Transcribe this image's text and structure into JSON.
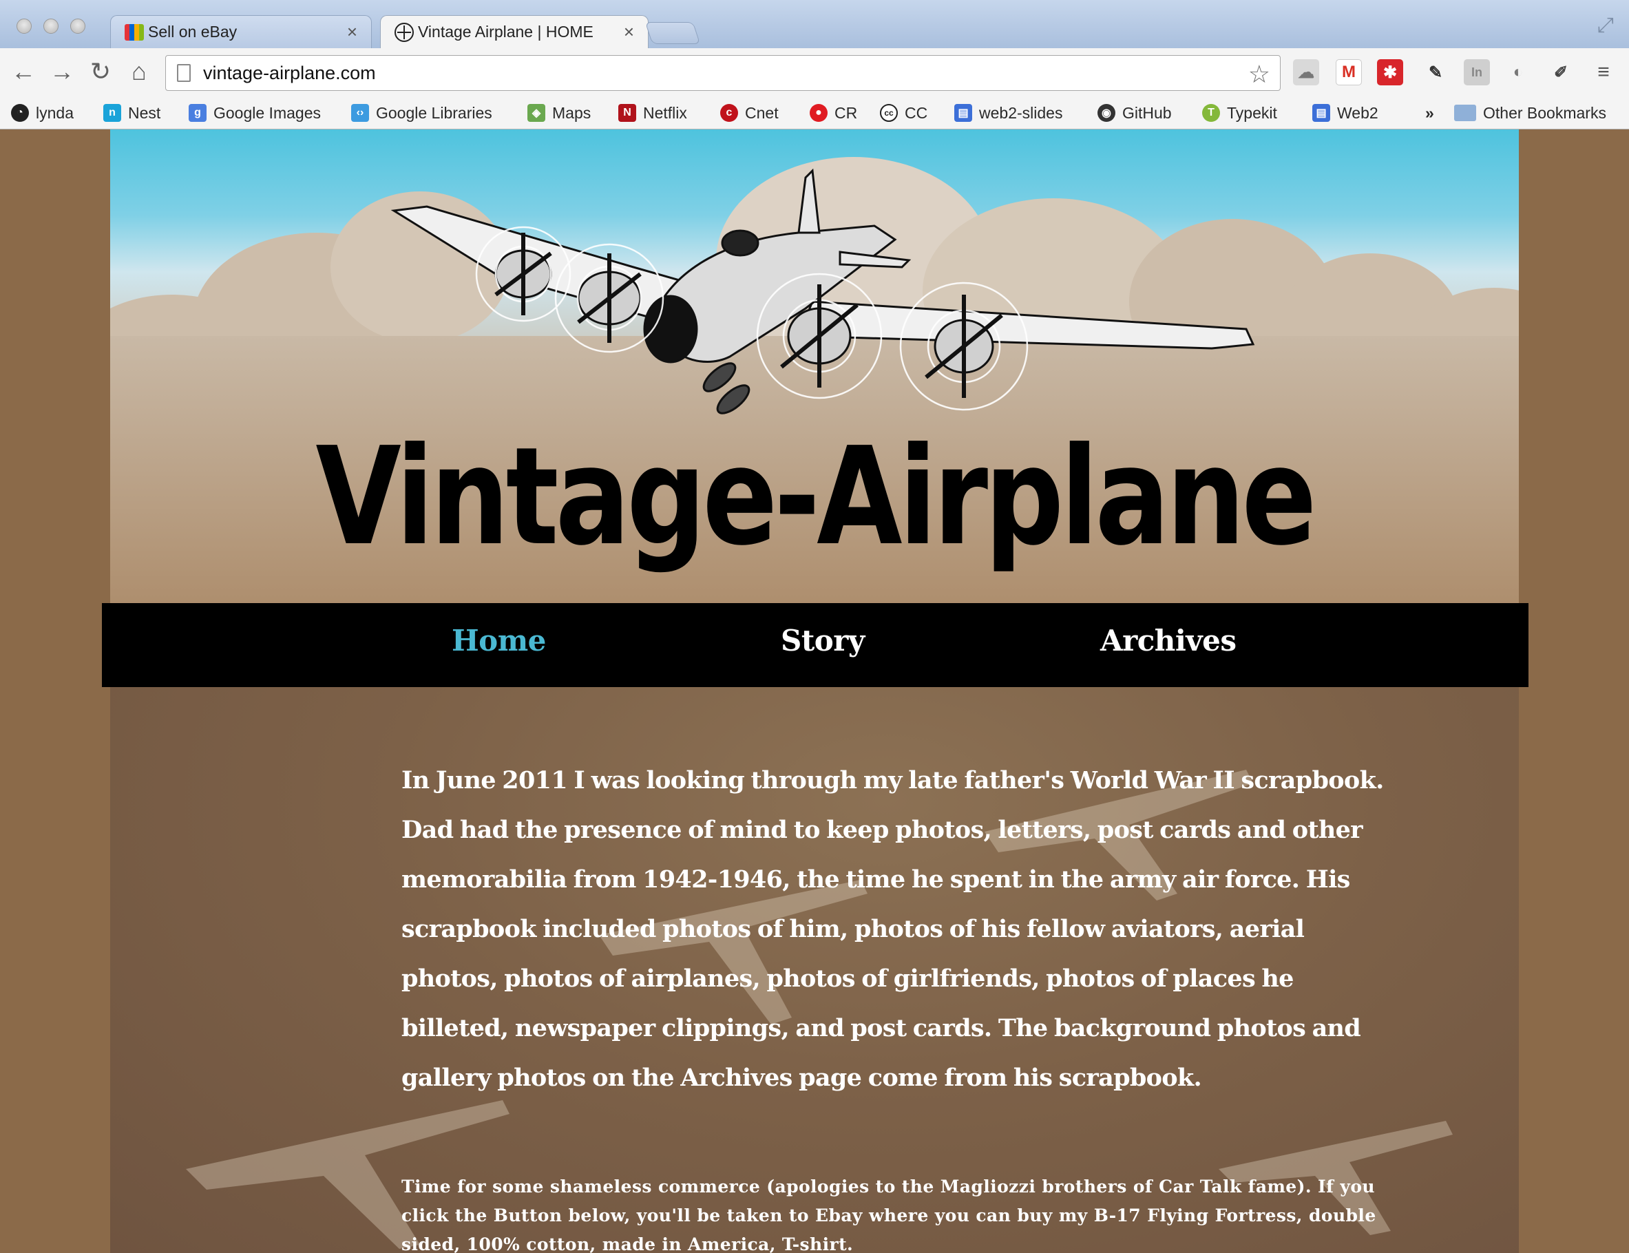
{
  "browser": {
    "tabs": [
      {
        "label": "Sell on eBay",
        "active": false
      },
      {
        "label": "Vintage Airplane | HOME",
        "active": true
      }
    ],
    "address": "vintage-airplane.com",
    "bookmarks": [
      {
        "label": "lynda",
        "icon": "lynda-icon",
        "color": "#333333"
      },
      {
        "label": "Nest",
        "icon": "nest-icon",
        "color": "#1aa3d9"
      },
      {
        "label": "Google Images",
        "icon": "google-images-icon",
        "color": "#4a7fe0"
      },
      {
        "label": "Google Libraries",
        "icon": "google-libraries-icon",
        "color": "#3d9be0"
      },
      {
        "label": "Maps",
        "icon": "maps-icon",
        "color": "#6aa84f"
      },
      {
        "label": "Netflix",
        "icon": "netflix-icon",
        "color": "#b0121b"
      },
      {
        "label": "Cnet",
        "icon": "cnet-icon",
        "color": "#c0121b"
      },
      {
        "label": "CR",
        "icon": "cr-icon",
        "color": "#e01b22"
      },
      {
        "label": "CC",
        "icon": "cc-icon",
        "color": "#222222"
      },
      {
        "label": "web2-slides",
        "icon": "slides-icon",
        "color": "#3c6fd8"
      },
      {
        "label": "GitHub",
        "icon": "github-icon",
        "color": "#333333"
      },
      {
        "label": "Typekit",
        "icon": "typekit-icon",
        "color": "#84b83a"
      },
      {
        "label": "Web2",
        "icon": "slides-icon",
        "color": "#3c6fd8"
      }
    ],
    "overflow": "»",
    "other_bookmarks": "Other Bookmarks"
  },
  "site": {
    "title": "Vintage-Airplane",
    "nav": [
      {
        "label": "Home",
        "current": true
      },
      {
        "label": "Story",
        "current": false
      },
      {
        "label": "Archives",
        "current": false
      }
    ],
    "intro": "In June 2011 I was looking through my late father's World War II scrapbook. Dad had the presence of mind to keep photos, letters, post cards and other memorabilia from 1942-1946, the time he spent in the army air force. His scrapbook included photos of him, photos of his fellow aviators, aerial photos, photos of airplanes, photos of girlfriends, photos of places he billeted, newspaper clippings, and post cards. The background photos and gallery photos on the Archives page come from his scrapbook.",
    "commerce": "Time for some shameless commerce (apologies to the Magliozzi brothers of Car Talk fame). If you click the Button below, you'll be taken to Ebay where you can buy my B-17 Flying Fortress, double sided, 100% cotton, made in America, T-shirt."
  },
  "colors": {
    "nav_current": "#4ab8d2",
    "nav_bar": "#000000",
    "page_bg": "#8b6a49"
  }
}
